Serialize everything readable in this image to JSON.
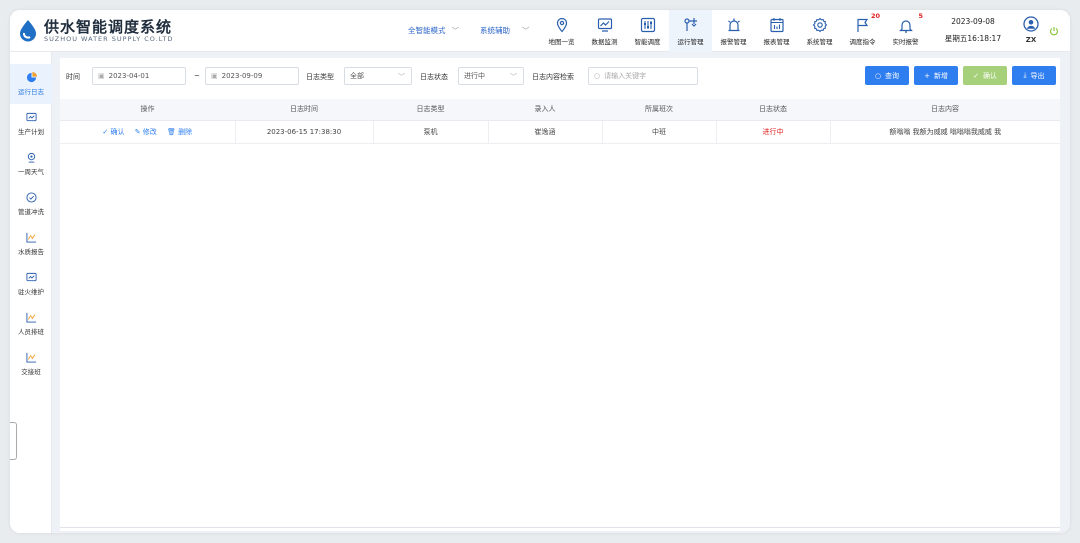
{
  "header": {
    "title": "供水智能调度系统",
    "subtitle": "SUZHOU WATER SUPPLY CO.LTD",
    "mode_label": "全智能模式",
    "assist_label": "系统辅助",
    "nav": [
      {
        "label": "地图一览",
        "icon": "map-pin-icon"
      },
      {
        "label": "数据监测",
        "icon": "monitor-chart-icon"
      },
      {
        "label": "智能调度",
        "icon": "sliders-icon"
      },
      {
        "label": "运行管理",
        "icon": "flow-network-icon"
      },
      {
        "label": "报警管理",
        "icon": "alarm-light-icon"
      },
      {
        "label": "报表管理",
        "icon": "report-calendar-icon"
      },
      {
        "label": "系统管理",
        "icon": "gear-icon"
      },
      {
        "label": "调度指令",
        "icon": "flag-icon",
        "badge": "20"
      },
      {
        "label": "实时报警",
        "icon": "bell-icon",
        "badge": "5"
      }
    ],
    "date": "2023-09-08",
    "weekday_time": "星期五16:18:17",
    "user": "ZX"
  },
  "sidebar": {
    "items": [
      {
        "label": "运行日志",
        "icon": "pie-chart-icon"
      },
      {
        "label": "生产计划",
        "icon": "screen-chart-icon"
      },
      {
        "label": "一周天气",
        "icon": "weather-icon"
      },
      {
        "label": "管道冲洗",
        "icon": "check-circle-icon"
      },
      {
        "label": "水质报告",
        "icon": "line-chart-icon"
      },
      {
        "label": "驻火维护",
        "icon": "screen-chart-icon"
      },
      {
        "label": "人员排班",
        "icon": "line-chart-icon"
      },
      {
        "label": "交接班",
        "icon": "line-chart-icon"
      }
    ]
  },
  "filters": {
    "time_label": "时间",
    "date_from": "2023-04-01",
    "tilde": "~",
    "date_to": "2023-09-09",
    "type_label": "日志类型",
    "type_value": "全部",
    "status_label": "日志状态",
    "status_value": "进行中",
    "search_label": "日志内容检索",
    "search_placeholder": "请输入关键字",
    "btn_query": "查询",
    "btn_add": "新增",
    "btn_confirm": "确认",
    "btn_export": "导出"
  },
  "table": {
    "columns": [
      "操作",
      "日志时间",
      "日志类型",
      "录入人",
      "所属班次",
      "日志状态",
      "日志内容"
    ],
    "rows": [
      {
        "actions": [
          "确认",
          "修改",
          "删除"
        ],
        "time": "2023-06-15 17:38:30",
        "type": "泵机",
        "person": "崔逸涵",
        "shift": "中班",
        "status": "进行中",
        "content": "额嗡嗡 我额为威威 嗡嗡嗡我威威 我"
      }
    ]
  },
  "colors": {
    "accent": "#2f7ef0",
    "confirm_green": "#a6d07a",
    "status_red": "#e02020"
  }
}
